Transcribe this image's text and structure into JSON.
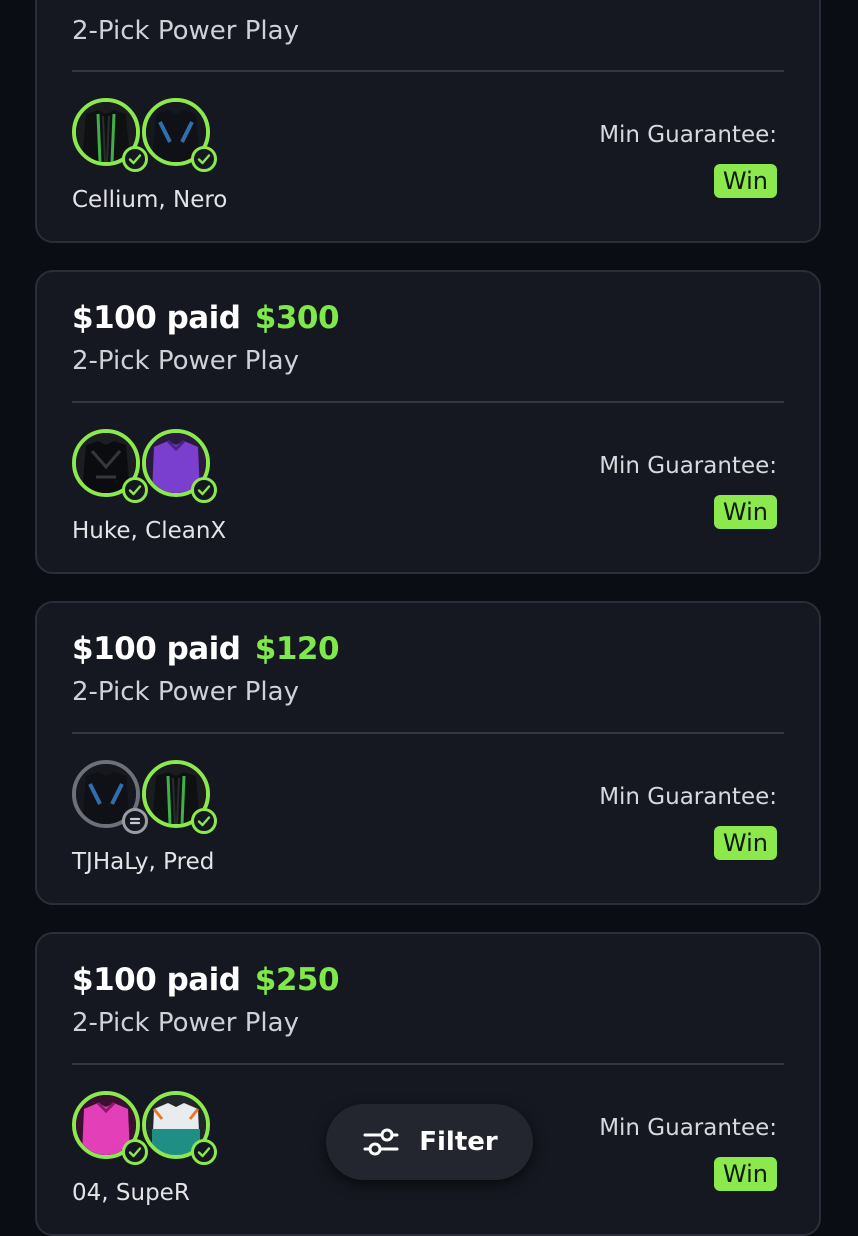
{
  "colors": {
    "accent": "#8be84d",
    "card_bg": "#161821",
    "page_bg": "#0b0d14"
  },
  "cards": [
    {
      "paid": "",
      "payout": "",
      "play_type": "2-Pick Power Play",
      "players": "Cellium, Nero",
      "min_guarantee_label": "Min Guarantee:",
      "result": "Win",
      "picks": [
        {
          "status": "check-icon",
          "jersey": "black-green"
        },
        {
          "status": "check-icon",
          "jersey": "black-blue"
        }
      ]
    },
    {
      "paid": "$100 paid",
      "payout": "$300",
      "play_type": "2-Pick Power Play",
      "players": "Huke, CleanX",
      "min_guarantee_label": "Min Guarantee:",
      "result": "Win",
      "picks": [
        {
          "status": "check-icon",
          "jersey": "black"
        },
        {
          "status": "check-icon",
          "jersey": "purple"
        }
      ]
    },
    {
      "paid": "$100 paid",
      "payout": "$120",
      "play_type": "2-Pick Power Play",
      "players": "TJHaLy, Pred",
      "min_guarantee_label": "Min Guarantee:",
      "result": "Win",
      "picks": [
        {
          "status": "push-icon",
          "jersey": "black-blue"
        },
        {
          "status": "check-icon",
          "jersey": "black-green"
        }
      ]
    },
    {
      "paid": "$100 paid",
      "payout": "$250",
      "play_type": "2-Pick Power Play",
      "players": "04, SupeR",
      "min_guarantee_label": "Min Guarantee:",
      "result": "Win",
      "picks": [
        {
          "status": "check-icon",
          "jersey": "pink"
        },
        {
          "status": "check-icon",
          "jersey": "white-teal"
        }
      ]
    }
  ],
  "filter": {
    "label": "Filter",
    "icon": "sliders-icon"
  }
}
